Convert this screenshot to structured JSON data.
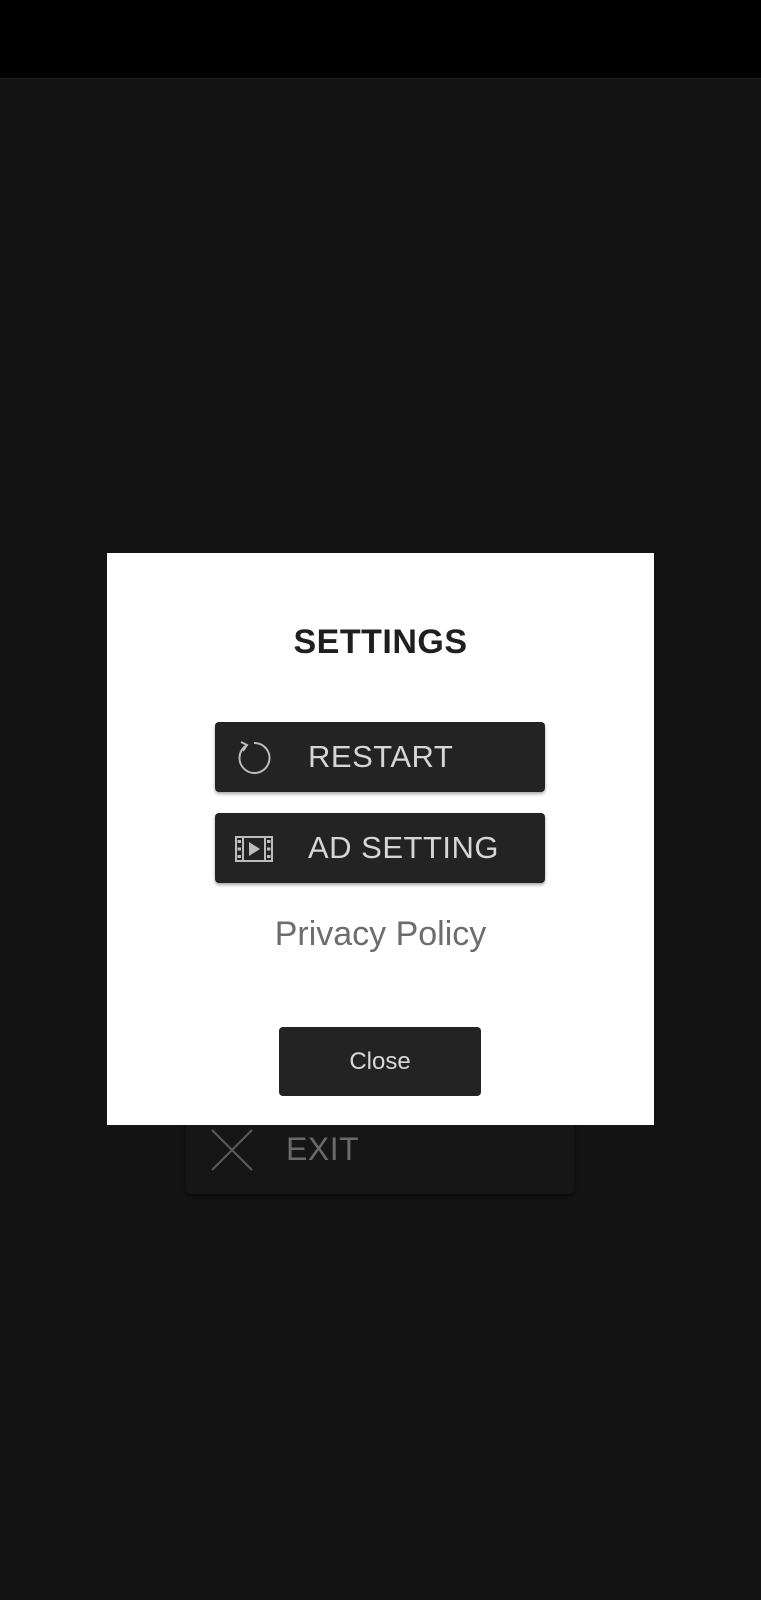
{
  "background": {
    "exit_button": {
      "label": "EXIT",
      "icon": "close-x-icon"
    }
  },
  "dialog": {
    "title": "SETTINGS",
    "restart_button": {
      "label": "RESTART",
      "icon": "restart-icon"
    },
    "ad_setting_button": {
      "label": "AD SETTING",
      "icon": "video-film-icon"
    },
    "privacy_link": "Privacy Policy",
    "close_button": "Close"
  },
  "colors": {
    "app_background": "#131313",
    "dialog_background": "#ffffff",
    "button_background": "#232323",
    "button_text": "#d6d6d6",
    "link_text": "#6d6d6d",
    "title_text": "#1f1f1f"
  }
}
